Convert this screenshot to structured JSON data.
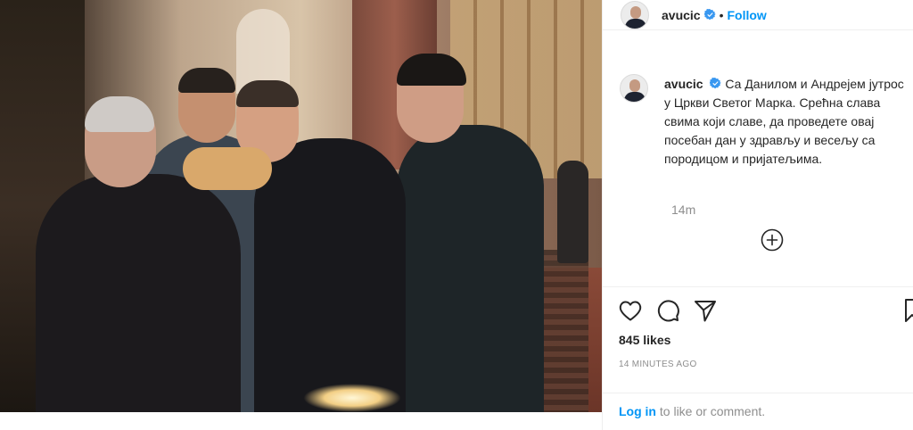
{
  "post": {
    "username": "avucic",
    "follow_label": "Follow",
    "separator": "•",
    "caption": "Са Данилом и Андрејем јутрос у Цркви Светог Марка. Срећна слава свима који славе, да проведете овај посебан дан у здрављу и весељу са породицом и пријатељима.",
    "caption_time": "14m",
    "likes": "845 likes",
    "timestamp": "14 MINUTES AGO",
    "login_link": "Log in",
    "login_suffix": " to like or comment."
  },
  "colors": {
    "accent": "#0095f6",
    "text": "#262626",
    "muted": "#8e8e8e",
    "border": "#efefef"
  },
  "icons": [
    "verified-badge-icon",
    "heart-icon",
    "comment-icon",
    "share-icon",
    "bookmark-icon",
    "add-comment-icon"
  ]
}
